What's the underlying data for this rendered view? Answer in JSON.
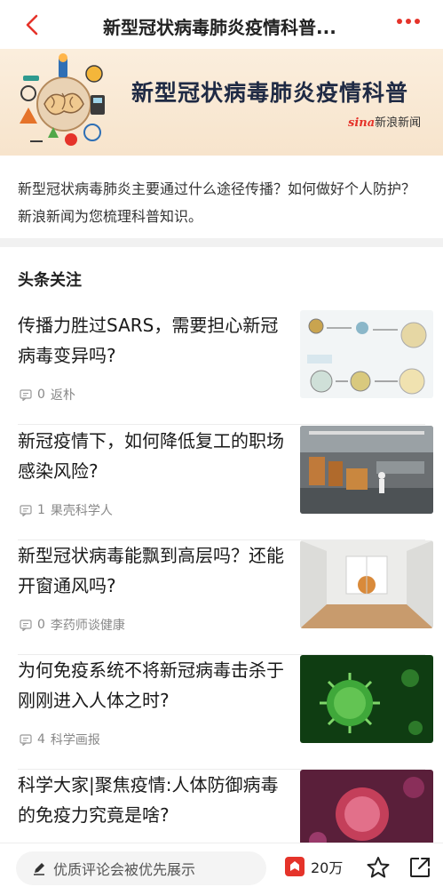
{
  "nav": {
    "title": "新型冠状病毒肺炎疫情科普...",
    "back_icon": "chevron-left-icon",
    "more_icon": "more-dots-icon",
    "accent": "#e5332a"
  },
  "banner": {
    "title": "新型冠状病毒肺炎疫情科普",
    "logo_brand": "sina",
    "logo_text": "新浪新闻"
  },
  "description": "新型冠状病毒肺炎主要通过什么途径传播？如何做好个人防护？新浪新闻为您梳理科普知识。",
  "section_title": "头条关注",
  "news": [
    {
      "headline": "传播力胜过SARS，需要担心新冠病毒变异吗?",
      "comments": "0",
      "source": "返朴"
    },
    {
      "headline": "新冠疫情下，如何降低复工的职场感染风险?",
      "comments": "1",
      "source": "果壳科学人"
    },
    {
      "headline": "新型冠状病毒能飘到高层吗？还能开窗通风吗?",
      "comments": "0",
      "source": "李药师谈健康"
    },
    {
      "headline": "为何免疫系统不将新冠病毒击杀于刚刚进入人体之时?",
      "comments": "4",
      "source": "科学画报"
    },
    {
      "headline": "科学大家|聚焦疫情:人体防御病毒的免疫力究竟是啥?",
      "comments": "",
      "source": ""
    }
  ],
  "bottom": {
    "comment_placeholder": "优质评论会被优先展示",
    "comment_count": "20万",
    "edit_icon": "pencil-icon",
    "comment_icon": "comment-badge-icon",
    "star_icon": "star-icon",
    "share_icon": "share-icon"
  }
}
